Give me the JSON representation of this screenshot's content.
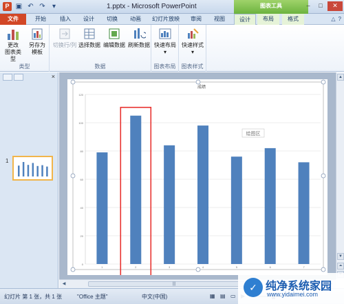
{
  "titlebar": {
    "app_logo": "P",
    "title": "1.pptx - Microsoft PowerPoint",
    "context_tools": "图表工具",
    "qat_icons": [
      "save-icon",
      "undo-icon",
      "redo-icon",
      "customize-icon"
    ],
    "controls": [
      "minimize-icon",
      "maximize-icon",
      "close-icon"
    ]
  },
  "tabs": {
    "file": "文件",
    "home": "开始",
    "insert": "插入",
    "design": "设计",
    "transitions": "切换",
    "animations": "动画",
    "slideshow": "幻灯片放映",
    "review": "审阅",
    "view": "视图",
    "chart_design": "设计",
    "chart_layout": "布局",
    "chart_format": "格式"
  },
  "ribbon": {
    "change_type_1": "更改",
    "change_type_2": "图表类型",
    "save_template_1": "另存为",
    "save_template_2": "模板",
    "group_type": "类型",
    "switch_row_col": "切换行/列",
    "select_data": "选择数据",
    "edit_data": "编辑数据",
    "refresh_data": "刷新数据",
    "group_data": "数据",
    "quick_layout": "快速布局",
    "group_layout": "图表布局",
    "quick_style": "快速样式",
    "group_style": "图表样式"
  },
  "left_panel": {
    "slide_number": "1"
  },
  "chart_data": {
    "type": "bar",
    "title": "成绩",
    "categories": [
      "1",
      "2",
      "3",
      "4",
      "5",
      "6",
      "7"
    ],
    "values": [
      79,
      105,
      84,
      98,
      76,
      82,
      72
    ],
    "ylim": [
      0,
      120
    ],
    "yticks": [
      "0",
      "20",
      "40",
      "60",
      "80",
      "100",
      "120"
    ],
    "plot_area_label": "绘图区",
    "bar_color": "#4f81bd",
    "highlight_index": 1,
    "highlight_color": "#e8322f",
    "grid": true
  },
  "statusbar": {
    "slide_info": "幻灯片 第 1 张，共 1 张",
    "theme": "\"Office 主题\"",
    "language": "中文(中国)"
  },
  "watermark": {
    "title": "纯净系统家园",
    "url": "www.yidaimei.com"
  }
}
